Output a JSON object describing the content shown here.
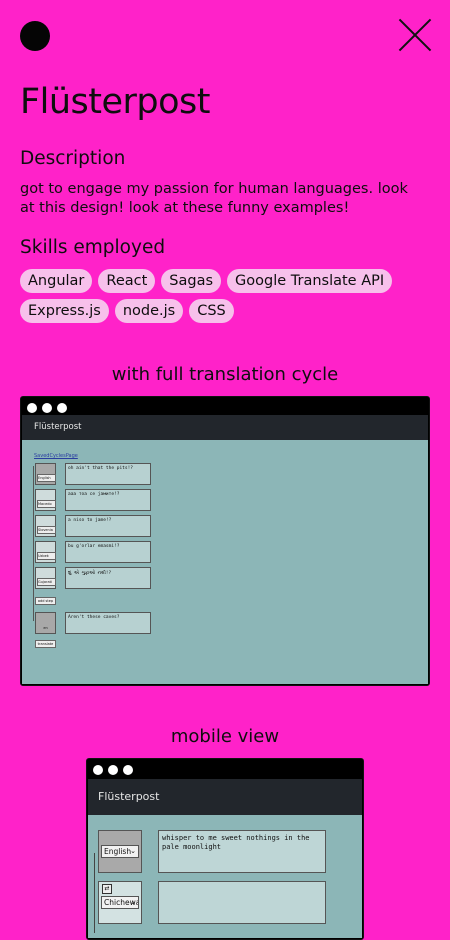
{
  "project": {
    "title": "Flüsterpost",
    "description_heading": "Description",
    "description": "got to engage my passion for human languages. look at this design! look at these funny examples!",
    "skills_heading": "Skills employed",
    "skills": [
      "Angular",
      "React",
      "Sagas",
      "Google Translate API",
      "Express.js",
      "node.js",
      "CSS"
    ]
  },
  "screenshots": [
    {
      "caption": "with full translation cycle",
      "app_title": "Flüsterpost",
      "link": "SavedCyclesPage",
      "rows": [
        {
          "lang": "English",
          "text": "oh ain't that the pits!?"
        },
        {
          "lang": "Macedo",
          "text": "ааа тоа се јамите!?"
        },
        {
          "lang": "Slovenia",
          "text": "a niso to jame!?"
        },
        {
          "lang": "Uzbek",
          "text": "bu g'orlar emasmi!?"
        },
        {
          "lang": "Gujarati",
          "text": "શું એ ગુફાઓ નથી!?"
        }
      ],
      "add_step_label": "add step",
      "final_lang": "en",
      "final_text": "Aren't these caves?",
      "translate_label": "translate"
    },
    {
      "caption": "mobile view",
      "app_title": "Flüsterpost",
      "rows": [
        {
          "lang": "English",
          "text": "whisper to me sweet nothings in the pale moonlight"
        },
        {
          "lang": "Chichewa",
          "text": ""
        }
      ]
    }
  ],
  "colors": {
    "background": "#ff22c9",
    "chip": "#f7c0eb",
    "app_bar": "#22262c",
    "app_body": "#8cb6b7"
  }
}
